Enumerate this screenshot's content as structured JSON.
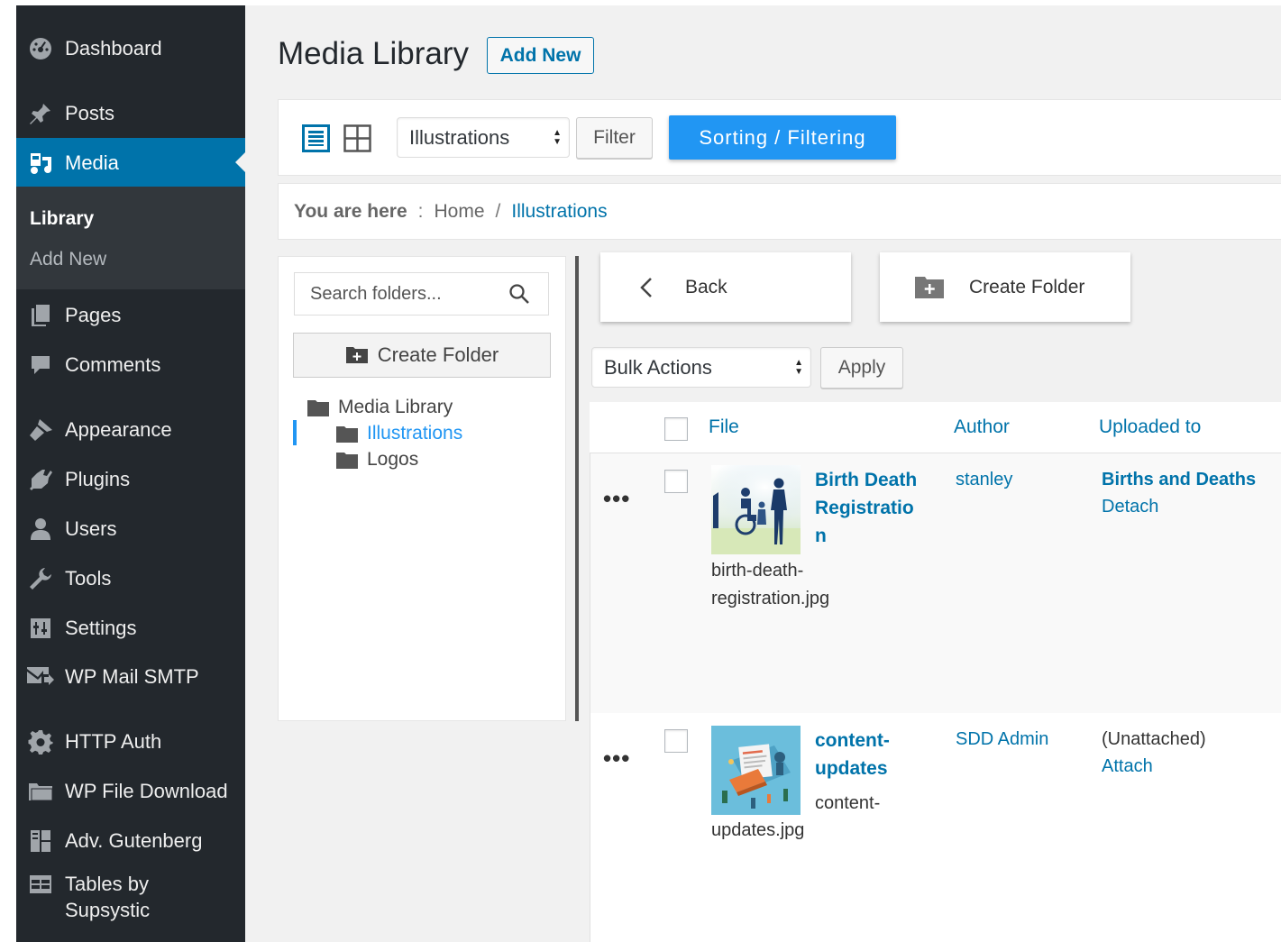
{
  "sidebar": {
    "items": [
      {
        "label": "Dashboard",
        "icon": "dashboard-icon"
      },
      {
        "label": "Posts",
        "icon": "pushpin-icon"
      },
      {
        "label": "Media",
        "icon": "media-icon"
      },
      {
        "label": "Pages",
        "icon": "pages-icon"
      },
      {
        "label": "Comments",
        "icon": "comment-icon"
      },
      {
        "label": "Appearance",
        "icon": "paintbrush-icon"
      },
      {
        "label": "Plugins",
        "icon": "plugin-icon"
      },
      {
        "label": "Users",
        "icon": "users-icon"
      },
      {
        "label": "Tools",
        "icon": "wrench-icon"
      },
      {
        "label": "Settings",
        "icon": "settings-icon"
      },
      {
        "label": "WP Mail SMTP",
        "icon": "mail-icon"
      },
      {
        "label": "HTTP Auth",
        "icon": "gear-icon"
      },
      {
        "label": "WP File Download",
        "icon": "folder-icon"
      },
      {
        "label": "Adv. Gutenberg",
        "icon": "grid-icon"
      },
      {
        "label_line1": "Tables by",
        "label_line2": "Supsystic",
        "icon": "table-icon"
      }
    ],
    "submenu": {
      "library": "Library",
      "add_new": "Add New"
    }
  },
  "header": {
    "title": "Media Library",
    "add_new": "Add New"
  },
  "toolbar": {
    "folder_select": "Illustrations",
    "filter": "Filter",
    "sorting": "Sorting / Filtering"
  },
  "breadcrumb": {
    "here": "You are here",
    "sep": ":",
    "home": "Home",
    "slash": "/",
    "current": "Illustrations"
  },
  "folders": {
    "search_placeholder": "Search folders...",
    "create": "Create Folder",
    "tree": {
      "root": "Media Library",
      "children": [
        "Illustrations",
        "Logos"
      ]
    }
  },
  "actions": {
    "back": "Back",
    "create_folder": "Create Folder"
  },
  "bulk": {
    "select": "Bulk Actions",
    "apply": "Apply"
  },
  "table": {
    "headers": {
      "file": "File",
      "author": "Author",
      "uploaded_to": "Uploaded to"
    },
    "rows": [
      {
        "title_lines": [
          "Birth Death",
          "Registratio",
          "n"
        ],
        "filename_lines": [
          "birth-death-",
          "registration.jpg"
        ],
        "author": "stanley",
        "uploaded_to": "Births and Deaths",
        "action": "Detach",
        "more": "•••"
      },
      {
        "title_lines": [
          "content-",
          "updates"
        ],
        "filename_lines": [
          "content-",
          "updates.jpg"
        ],
        "author": "SDD Admin",
        "uploaded_to": "(Unattached)",
        "action": "Attach",
        "more": "•••"
      }
    ]
  },
  "colors": {
    "sidebar": "#23282d",
    "active": "#0073aa",
    "accent": "#2196f3",
    "link": "#0073aa"
  }
}
